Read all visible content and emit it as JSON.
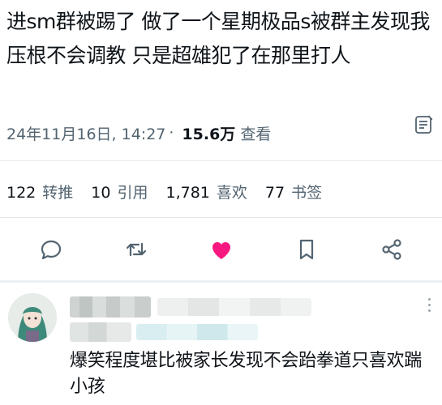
{
  "post": {
    "text": "进sm群被踢了 做了一个星期极品s被群主发现我压根不会调教 只是超雄犯了在那里打人",
    "date": "24年11月16日, 14:27",
    "views_count": "15.6万",
    "views_label": "查看"
  },
  "stats": {
    "retweets_count": "122",
    "retweets_label": "转推",
    "quotes_count": "10",
    "quotes_label": "引用",
    "likes_count": "1,781",
    "likes_label": "喜欢",
    "bookmarks_count": "77",
    "bookmarks_label": "书签"
  },
  "actions": {
    "reply_icon": "reply-icon",
    "retweet_icon": "retweet-icon",
    "like_icon": "heart-icon",
    "bookmark_icon": "bookmark-icon",
    "share_icon": "share-icon",
    "like_color": "#f91880",
    "icon_color": "#536471"
  },
  "reply": {
    "text": "爆笑程度堪比被家长发现不会跆拳道只喜欢踹小孩"
  }
}
